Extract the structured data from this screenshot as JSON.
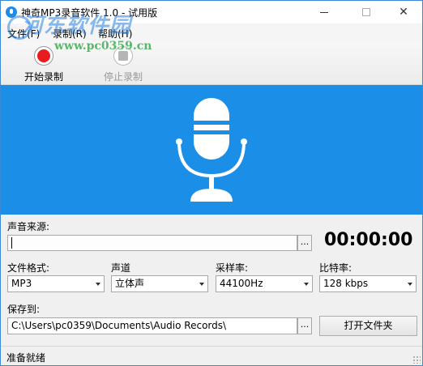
{
  "window": {
    "title": "神奇MP3录音软件 1.0 - 试用版",
    "controls": {
      "minimize": "—",
      "close": "✕"
    }
  },
  "watermark": {
    "text": "河东软件园",
    "url": "www.pc0359.cn"
  },
  "menu": [
    {
      "label": "文件(F)"
    },
    {
      "label": "录制(R)"
    },
    {
      "label": "帮助(H)"
    }
  ],
  "toolbar": {
    "start_label": "开始录制",
    "stop_label": "停止录制"
  },
  "form": {
    "source_label": "声音来源:",
    "source_value": "",
    "browse_label": "...",
    "timer": "00:00:00",
    "format_label": "文件格式:",
    "format_value": "MP3",
    "channel_label": "声道",
    "channel_value": "立体声",
    "samplerate_label": "采样率:",
    "samplerate_value": "44100Hz",
    "bitrate_label": "比特率:",
    "bitrate_value": "128 kbps",
    "save_label": "保存到:",
    "save_path": "C:\\Users\\pc0359\\Documents\\Audio Records\\",
    "open_folder_label": "打开文件夹"
  },
  "status": {
    "text": "准备就绪"
  },
  "colors": {
    "hero_bg": "#1b8fe8",
    "record_red": "#e81c1c",
    "window_border": "#3c8ad6"
  },
  "icons": [
    "app-icon",
    "record-icon",
    "stop-icon",
    "microphone-icon"
  ]
}
